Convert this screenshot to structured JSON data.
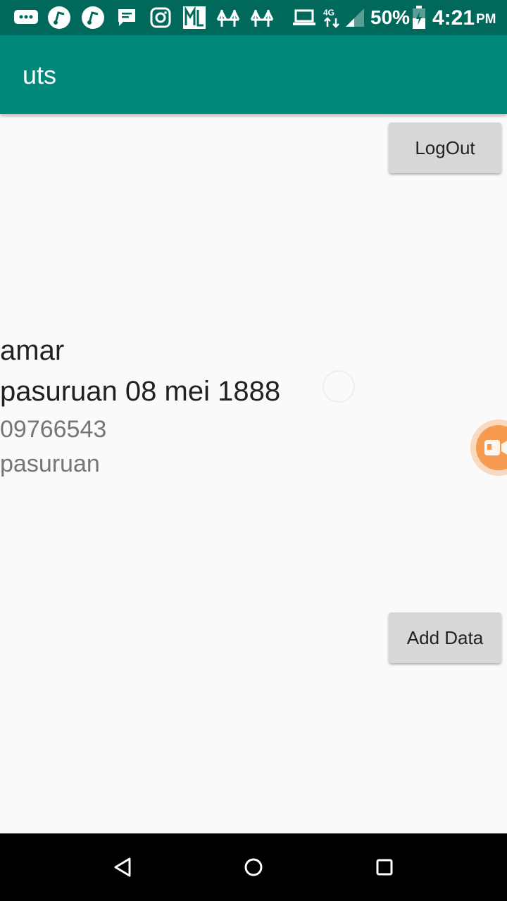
{
  "status_bar": {
    "battery_percent": "50%",
    "time": "4:21",
    "ampm": "PM",
    "icons": [
      "message-icon",
      "music-icon",
      "music-icon",
      "chat-icon",
      "instagram-icon",
      "ml-icon",
      "bridge-icon",
      "bridge-icon",
      "laptop-icon",
      "data-icon",
      "signal-icon",
      "battery-icon"
    ]
  },
  "app_bar": {
    "title": "uts"
  },
  "buttons": {
    "logout": "LogOut",
    "add_data": "Add Data"
  },
  "record": {
    "name": "amar",
    "birth": "pasuruan 08 mei 1888",
    "phone": "09766543",
    "city": "pasuruan"
  },
  "colors": {
    "status_bar": "#00695c",
    "app_bar": "#00897b",
    "button": "#d6d7d7",
    "floating_bubble": "#f59a4f"
  }
}
